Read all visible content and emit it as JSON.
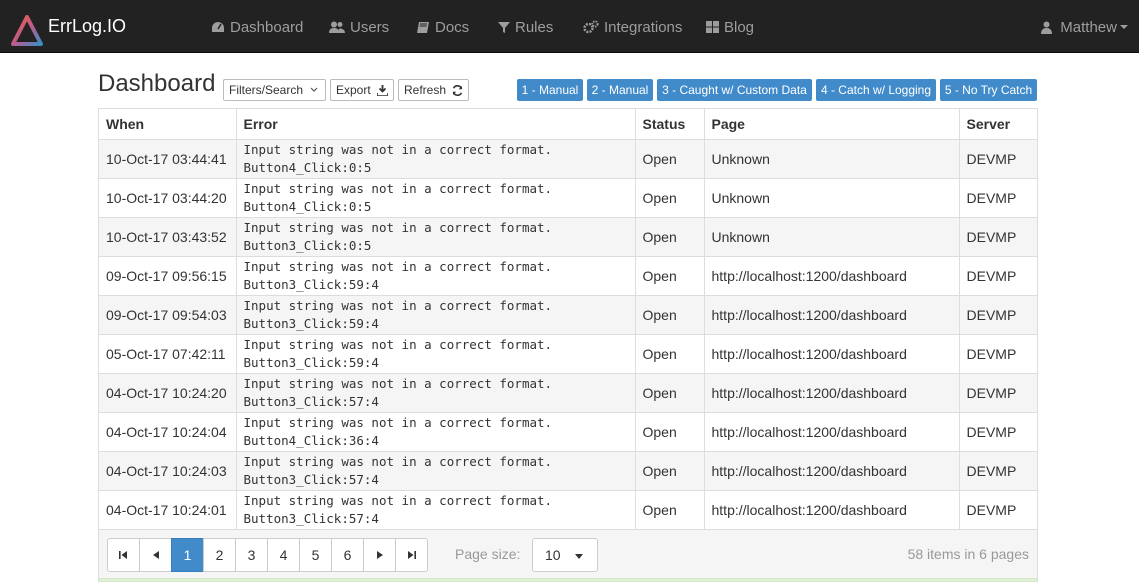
{
  "navbar": {
    "brand": "ErrLog.IO",
    "items": [
      {
        "label": "Dashboard",
        "icon": "dashboard-icon"
      },
      {
        "label": "Users",
        "icon": "users-icon"
      },
      {
        "label": "Docs",
        "icon": "book-icon"
      },
      {
        "label": "Rules",
        "icon": "filter-icon"
      },
      {
        "label": "Integrations",
        "icon": "cogs-icon"
      },
      {
        "label": "Blog",
        "icon": "grid-icon"
      }
    ],
    "user": "Matthew"
  },
  "header": {
    "title": "Dashboard",
    "filters_label": "Filters/Search",
    "export_label": "Export",
    "refresh_label": "Refresh",
    "test_buttons": [
      "1 - Manual",
      "2 - Manual",
      "3 - Caught w/ Custom Data",
      "4 - Catch w/ Logging",
      "5 - No Try Catch"
    ]
  },
  "table": {
    "columns": [
      "When",
      "Error",
      "Status",
      "Page",
      "Server"
    ],
    "rows": [
      {
        "when": "10-Oct-17 03:44:41",
        "error1": "Input string was not in a correct format.",
        "error2": "Button4_Click:0:5",
        "status": "Open",
        "page": "Unknown",
        "server": "DEVMP"
      },
      {
        "when": "10-Oct-17 03:44:20",
        "error1": "Input string was not in a correct format.",
        "error2": "Button4_Click:0:5",
        "status": "Open",
        "page": "Unknown",
        "server": "DEVMP"
      },
      {
        "when": "10-Oct-17 03:43:52",
        "error1": "Input string was not in a correct format.",
        "error2": "Button3_Click:0:5",
        "status": "Open",
        "page": "Unknown",
        "server": "DEVMP"
      },
      {
        "when": "09-Oct-17 09:56:15",
        "error1": "Input string was not in a correct format.",
        "error2": "Button3_Click:59:4",
        "status": "Open",
        "page": "http://localhost:1200/dashboard",
        "server": "DEVMP"
      },
      {
        "when": "09-Oct-17 09:54:03",
        "error1": "Input string was not in a correct format.",
        "error2": "Button3_Click:59:4",
        "status": "Open",
        "page": "http://localhost:1200/dashboard",
        "server": "DEVMP"
      },
      {
        "when": "05-Oct-17 07:42:11",
        "error1": "Input string was not in a correct format.",
        "error2": "Button3_Click:59:4",
        "status": "Open",
        "page": "http://localhost:1200/dashboard",
        "server": "DEVMP"
      },
      {
        "when": "04-Oct-17 10:24:20",
        "error1": "Input string was not in a correct format.",
        "error2": "Button3_Click:57:4",
        "status": "Open",
        "page": "http://localhost:1200/dashboard",
        "server": "DEVMP"
      },
      {
        "when": "04-Oct-17 10:24:04",
        "error1": "Input string was not in a correct format.",
        "error2": "Button4_Click:36:4",
        "status": "Open",
        "page": "http://localhost:1200/dashboard",
        "server": "DEVMP"
      },
      {
        "when": "04-Oct-17 10:24:03",
        "error1": "Input string was not in a correct format.",
        "error2": "Button3_Click:57:4",
        "status": "Open",
        "page": "http://localhost:1200/dashboard",
        "server": "DEVMP"
      },
      {
        "when": "04-Oct-17 10:24:01",
        "error1": "Input string was not in a correct format.",
        "error2": "Button3_Click:57:4",
        "status": "Open",
        "page": "http://localhost:1200/dashboard",
        "server": "DEVMP"
      }
    ]
  },
  "pager": {
    "pages": [
      "1",
      "2",
      "3",
      "4",
      "5",
      "6"
    ],
    "current_page": "1",
    "page_size_label": "Page size:",
    "page_size": "10",
    "info": "58 items in 6 pages"
  },
  "colors": {
    "navbar_bg": "#222222",
    "nav_text": "#9d9d9d",
    "accent_blue": "#428bca"
  }
}
